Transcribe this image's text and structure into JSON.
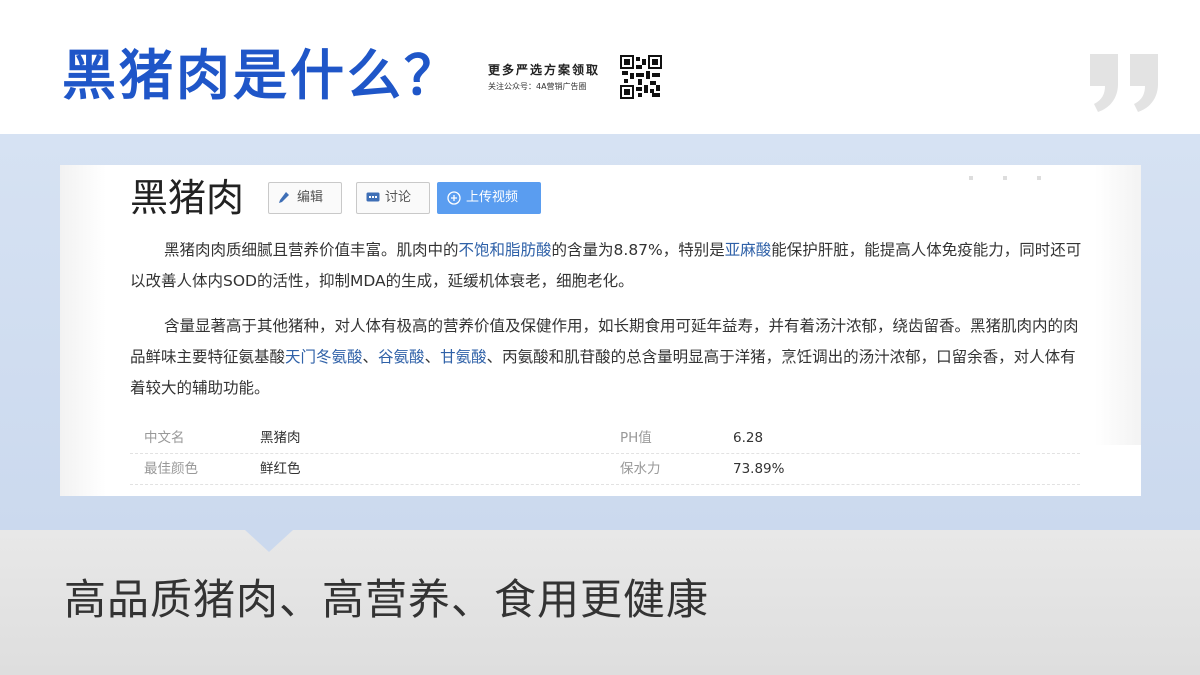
{
  "header": {
    "title": "黑猪肉是什么？",
    "promo_line1": "更多严选方案领取",
    "promo_line2": "关注公众号：4A营销广告圈",
    "qr_icon": "qr-code-icon",
    "quote_icon": "closing-quote-icon"
  },
  "card": {
    "entry_title": "黑猪肉",
    "buttons": {
      "edit": "编辑",
      "discuss": "讨论",
      "upload": "上传视频"
    },
    "paragraph1": {
      "t1": "黑猪肉肉质细腻且营养价值丰富。肌肉中的",
      "l1": "不饱和脂肪酸",
      "t2": "的含量为8.87%，特别是",
      "l2": "亚麻酸",
      "t3": "能保护肝脏，能提高人体免疫能力，同时还可以改善人体内SOD的活性，抑制MDA的生成，延缓机体衰老，细胞老化。"
    },
    "paragraph2": {
      "t1": "含量显著高于其他猪种，对人体有极高的营养价值及保健作用，如长期食用可延年益寿，并有着汤汁浓郁，绕齿留香。黑猪肌肉内的肉品鲜味主要特征氨基酸",
      "l1": "天门冬氨酸",
      "s1": "、",
      "l2": "谷氨酸",
      "s2": "、",
      "l3": "甘氨酸",
      "t2": "、丙氨酸和肌苷酸的总含量明显高于洋猪，烹饪调出的汤汁浓郁，口留余香，对人体有着较大的辅助功能。"
    },
    "info_rows": [
      {
        "k1": "中文名",
        "v1": "黑猪肉",
        "k2": "PH值",
        "v2": "6.28"
      },
      {
        "k1": "最佳颜色",
        "v1": "鲜红色",
        "k2": "保水力",
        "v2": "73.89%"
      }
    ]
  },
  "slogan": "高品质猪肉、高营养、食用更健康",
  "colors": {
    "title_blue": "#1f56c8",
    "band_blue": "#cbd9ee",
    "link_blue": "#2f61a8",
    "upload_button": "#5a9df0"
  }
}
